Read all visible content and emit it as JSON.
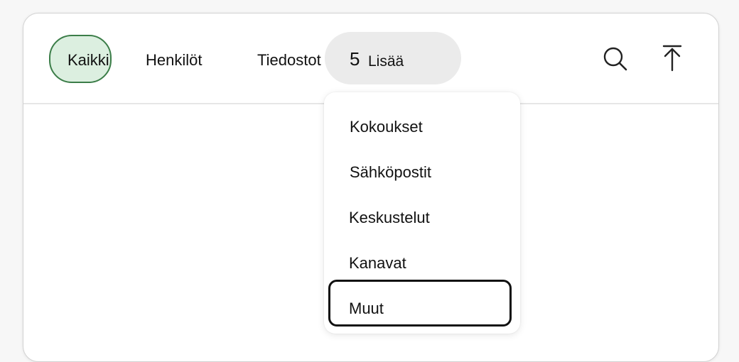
{
  "tabs": {
    "all": "Kaikki",
    "people": "Henkilöt",
    "files": "Tiedostot"
  },
  "more": {
    "count": "5",
    "label": "Lisää"
  },
  "icons": {
    "search": "search-icon",
    "upload": "arrow-up-to-line-icon"
  },
  "dropdown": {
    "items": [
      "Kokoukset",
      "Sähköpostit",
      "Keskustelut",
      "Kanavat",
      "Muut"
    ]
  },
  "colors": {
    "selected_tab_bg": "#dcefe0",
    "selected_tab_border": "#3b7d48",
    "more_pill_bg": "#ebebeb"
  }
}
